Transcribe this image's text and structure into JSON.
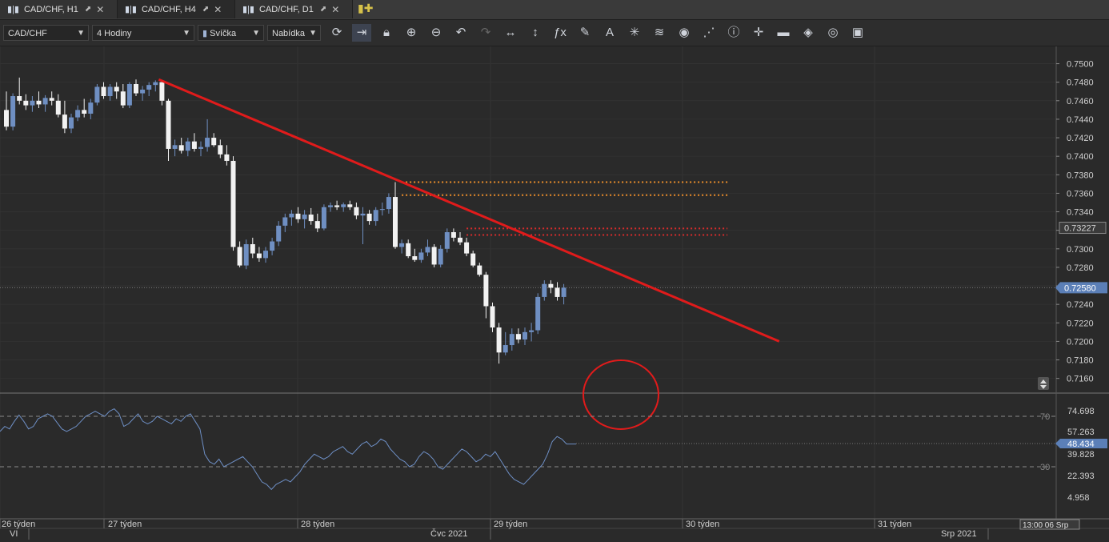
{
  "tabs": [
    {
      "label": "CAD/CHF, H1"
    },
    {
      "label": "CAD/CHF, H4"
    },
    {
      "label": "CAD/CHF, D1"
    }
  ],
  "toolbar": {
    "symbol": "CAD/CHF",
    "timeframe": "4 Hodiny",
    "chart_type": "Svíčka",
    "price_type": "Nabídka",
    "icons": [
      "refresh-icon",
      "autoscroll-icon",
      "lock-icon",
      "zoom-in-icon",
      "zoom-out-icon",
      "undo-icon",
      "redo-icon",
      "horizontal-measure-icon",
      "vertical-measure-icon",
      "indicator-fx-icon",
      "pencil-icon",
      "text-tool-icon",
      "crosshair-star-icon",
      "layers-icon",
      "eye-icon",
      "signals-icon",
      "info-icon",
      "cursor-cross-icon",
      "ruler-colors-icon",
      "fill-bucket-icon",
      "cycle-icon",
      "save-icon"
    ]
  },
  "price_axis": {
    "labels": [
      "0.7500",
      "0.7480",
      "0.7460",
      "0.7440",
      "0.7420",
      "0.7400",
      "0.7380",
      "0.7360",
      "0.7340",
      "0.7320",
      "0.7300",
      "0.7280",
      "0.7260",
      "0.7240",
      "0.7220",
      "0.7200",
      "0.7180",
      "0.7160"
    ],
    "current_price": "0.72580",
    "marked_price": "0.73227"
  },
  "rsi_axis": {
    "labels": [
      "74.698",
      "57.263",
      "39.828",
      "22.393",
      "4.958"
    ],
    "current_value": "48.434",
    "level_high": "70",
    "level_low": "30"
  },
  "time_axis": {
    "weeks": [
      "26 týden",
      "27 týden",
      "28 týden",
      "29 týden",
      "30 týden",
      "31 týden"
    ],
    "months": [
      "VI",
      "Čvc 2021",
      "Srp 2021"
    ],
    "cursor_time": "13:00 06 Srp"
  },
  "colors": {
    "bull": "#6f8fc2",
    "bear": "#f2f2f2",
    "trendline": "#e01b1b",
    "resistance_orange": "#f0902a",
    "resistance_red": "#d82c2c",
    "rsi_line": "#6e8fc5"
  },
  "chart_data": {
    "type": "candlestick",
    "price_range": [
      0.7145,
      0.751
    ],
    "rsi_range": [
      0,
      100
    ],
    "candles": [
      [
        0.745,
        0.747,
        0.7428,
        0.7432
      ],
      [
        0.7432,
        0.7468,
        0.7428,
        0.7465
      ],
      [
        0.7465,
        0.7485,
        0.7456,
        0.746
      ],
      [
        0.746,
        0.7467,
        0.745,
        0.7455
      ],
      [
        0.7455,
        0.7465,
        0.7448,
        0.746
      ],
      [
        0.746,
        0.747,
        0.7452,
        0.7456
      ],
      [
        0.7456,
        0.7466,
        0.7448,
        0.7463
      ],
      [
        0.7463,
        0.747,
        0.7455,
        0.746
      ],
      [
        0.746,
        0.7467,
        0.7442,
        0.7445
      ],
      [
        0.7445,
        0.746,
        0.7425,
        0.743
      ],
      [
        0.743,
        0.7446,
        0.7425,
        0.7442
      ],
      [
        0.7442,
        0.7455,
        0.7438,
        0.745
      ],
      [
        0.745,
        0.7462,
        0.7442,
        0.7446
      ],
      [
        0.7446,
        0.7462,
        0.744,
        0.7458
      ],
      [
        0.7458,
        0.7478,
        0.7455,
        0.7475
      ],
      [
        0.7475,
        0.748,
        0.7462,
        0.7465
      ],
      [
        0.7465,
        0.7478,
        0.746,
        0.7475
      ],
      [
        0.7475,
        0.748,
        0.7462,
        0.747
      ],
      [
        0.747,
        0.7478,
        0.7452,
        0.7455
      ],
      [
        0.7455,
        0.748,
        0.7452,
        0.7478
      ],
      [
        0.7478,
        0.7483,
        0.7465,
        0.7468
      ],
      [
        0.7468,
        0.7476,
        0.746,
        0.7472
      ],
      [
        0.7472,
        0.748,
        0.7465,
        0.7477
      ],
      [
        0.7477,
        0.7482,
        0.747,
        0.748
      ],
      [
        0.748,
        0.7482,
        0.7455,
        0.746
      ],
      [
        0.746,
        0.7462,
        0.7395,
        0.7408
      ],
      [
        0.7408,
        0.7418,
        0.74,
        0.7412
      ],
      [
        0.7412,
        0.742,
        0.7403,
        0.7406
      ],
      [
        0.7406,
        0.742,
        0.74,
        0.7416
      ],
      [
        0.7416,
        0.7425,
        0.7405,
        0.7408
      ],
      [
        0.7408,
        0.7416,
        0.74,
        0.741
      ],
      [
        0.741,
        0.744,
        0.7405,
        0.742
      ],
      [
        0.742,
        0.7425,
        0.741,
        0.7412
      ],
      [
        0.7412,
        0.7418,
        0.7398,
        0.7402
      ],
      [
        0.7402,
        0.7412,
        0.739,
        0.7395
      ],
      [
        0.7395,
        0.74,
        0.7298,
        0.7302
      ],
      [
        0.7302,
        0.7308,
        0.728,
        0.7282
      ],
      [
        0.7282,
        0.731,
        0.7278,
        0.7305
      ],
      [
        0.7305,
        0.7312,
        0.729,
        0.7295
      ],
      [
        0.7295,
        0.7302,
        0.7286,
        0.729
      ],
      [
        0.729,
        0.7302,
        0.7285,
        0.7298
      ],
      [
        0.7298,
        0.7312,
        0.7293,
        0.7308
      ],
      [
        0.7308,
        0.733,
        0.7303,
        0.7325
      ],
      [
        0.7325,
        0.7338,
        0.7318,
        0.7334
      ],
      [
        0.7334,
        0.7342,
        0.7325,
        0.7338
      ],
      [
        0.7338,
        0.7345,
        0.7328,
        0.7332
      ],
      [
        0.7332,
        0.7342,
        0.7322,
        0.7337
      ],
      [
        0.7337,
        0.7344,
        0.7326,
        0.733
      ],
      [
        0.733,
        0.7338,
        0.7318,
        0.7322
      ],
      [
        0.7322,
        0.7348,
        0.732,
        0.7345
      ],
      [
        0.7345,
        0.735,
        0.734,
        0.7347
      ],
      [
        0.7347,
        0.7352,
        0.7342,
        0.7345
      ],
      [
        0.7345,
        0.735,
        0.734,
        0.7348
      ],
      [
        0.7348,
        0.7352,
        0.7342,
        0.7345
      ],
      [
        0.7345,
        0.735,
        0.7332,
        0.7336
      ],
      [
        0.7336,
        0.7345,
        0.7305,
        0.7338
      ],
      [
        0.7338,
        0.7342,
        0.7326,
        0.733
      ],
      [
        0.733,
        0.7345,
        0.7325,
        0.7342
      ],
      [
        0.7342,
        0.735,
        0.7336,
        0.7343
      ],
      [
        0.7343,
        0.736,
        0.7338,
        0.7356
      ],
      [
        0.7356,
        0.7372,
        0.73,
        0.7302
      ],
      [
        0.7302,
        0.731,
        0.7295,
        0.7306
      ],
      [
        0.7306,
        0.731,
        0.729,
        0.7292
      ],
      [
        0.7292,
        0.73,
        0.7286,
        0.7288
      ],
      [
        0.7288,
        0.73,
        0.7285,
        0.7296
      ],
      [
        0.7296,
        0.731,
        0.7292,
        0.7302
      ],
      [
        0.7302,
        0.7305,
        0.728,
        0.7283
      ],
      [
        0.7283,
        0.7304,
        0.728,
        0.73
      ],
      [
        0.73,
        0.7322,
        0.7296,
        0.7318
      ],
      [
        0.7318,
        0.7322,
        0.7308,
        0.7312
      ],
      [
        0.7312,
        0.7318,
        0.7304,
        0.7307
      ],
      [
        0.7307,
        0.7312,
        0.7292,
        0.7295
      ],
      [
        0.7295,
        0.7298,
        0.728,
        0.7282
      ],
      [
        0.7282,
        0.7285,
        0.727,
        0.7272
      ],
      [
        0.7272,
        0.7275,
        0.7225,
        0.7238
      ],
      [
        0.7238,
        0.7242,
        0.721,
        0.7215
      ],
      [
        0.7215,
        0.722,
        0.7176,
        0.7188
      ],
      [
        0.7188,
        0.721,
        0.7185,
        0.7196
      ],
      [
        0.7196,
        0.7214,
        0.719,
        0.7208
      ],
      [
        0.7208,
        0.7214,
        0.7198,
        0.7202
      ],
      [
        0.7202,
        0.7215,
        0.7196,
        0.721
      ],
      [
        0.721,
        0.722,
        0.72,
        0.7212
      ],
      [
        0.7212,
        0.7252,
        0.7208,
        0.7248
      ],
      [
        0.7248,
        0.7266,
        0.7244,
        0.7262
      ],
      [
        0.7262,
        0.7266,
        0.7252,
        0.7258
      ],
      [
        0.7258,
        0.7264,
        0.7244,
        0.7248
      ],
      [
        0.7248,
        0.7262,
        0.724,
        0.7258
      ]
    ],
    "rsi": [
      58,
      62,
      60,
      66,
      71,
      66,
      60,
      62,
      68,
      70,
      72,
      70,
      65,
      60,
      58,
      60,
      62,
      66,
      70,
      72,
      74,
      72,
      70,
      74,
      76,
      72,
      62,
      64,
      68,
      72,
      66,
      64,
      66,
      70,
      68,
      66,
      64,
      68,
      66,
      70,
      72,
      66,
      60,
      40,
      34,
      32,
      36,
      30,
      32,
      34,
      36,
      38,
      34,
      30,
      24,
      18,
      16,
      12,
      16,
      18,
      20,
      18,
      22,
      26,
      32,
      36,
      40,
      38,
      36,
      38,
      42,
      44,
      46,
      42,
      40,
      44,
      48,
      50,
      46,
      48,
      52,
      50,
      44,
      40,
      36,
      34,
      30,
      32,
      38,
      42,
      40,
      36,
      30,
      28,
      32,
      36,
      40,
      44,
      42,
      38,
      34,
      36,
      40,
      38,
      42,
      36,
      30,
      24,
      20,
      18,
      16,
      20,
      24,
      28,
      32,
      40,
      50,
      54,
      52,
      48,
      48,
      48
    ],
    "trendline": {
      "from": {
        "bar": 24,
        "price": 0.7483
      },
      "to": {
        "bar": 118,
        "price": 0.72
      }
    },
    "resistance_levels": [
      {
        "price": 0.7372,
        "from_bar": 61,
        "to_bar": 111,
        "color": "orange"
      },
      {
        "price": 0.7358,
        "from_bar": 61,
        "to_bar": 111,
        "color": "orange"
      },
      {
        "price": 0.7322,
        "from_bar": 71,
        "to_bar": 111,
        "color": "red"
      },
      {
        "price": 0.7315,
        "from_bar": 71,
        "to_bar": 111,
        "color": "red"
      }
    ],
    "ellipse_center": {
      "bar": 96,
      "price": 0.7154
    },
    "rsi_levels": [
      70,
      30
    ]
  }
}
